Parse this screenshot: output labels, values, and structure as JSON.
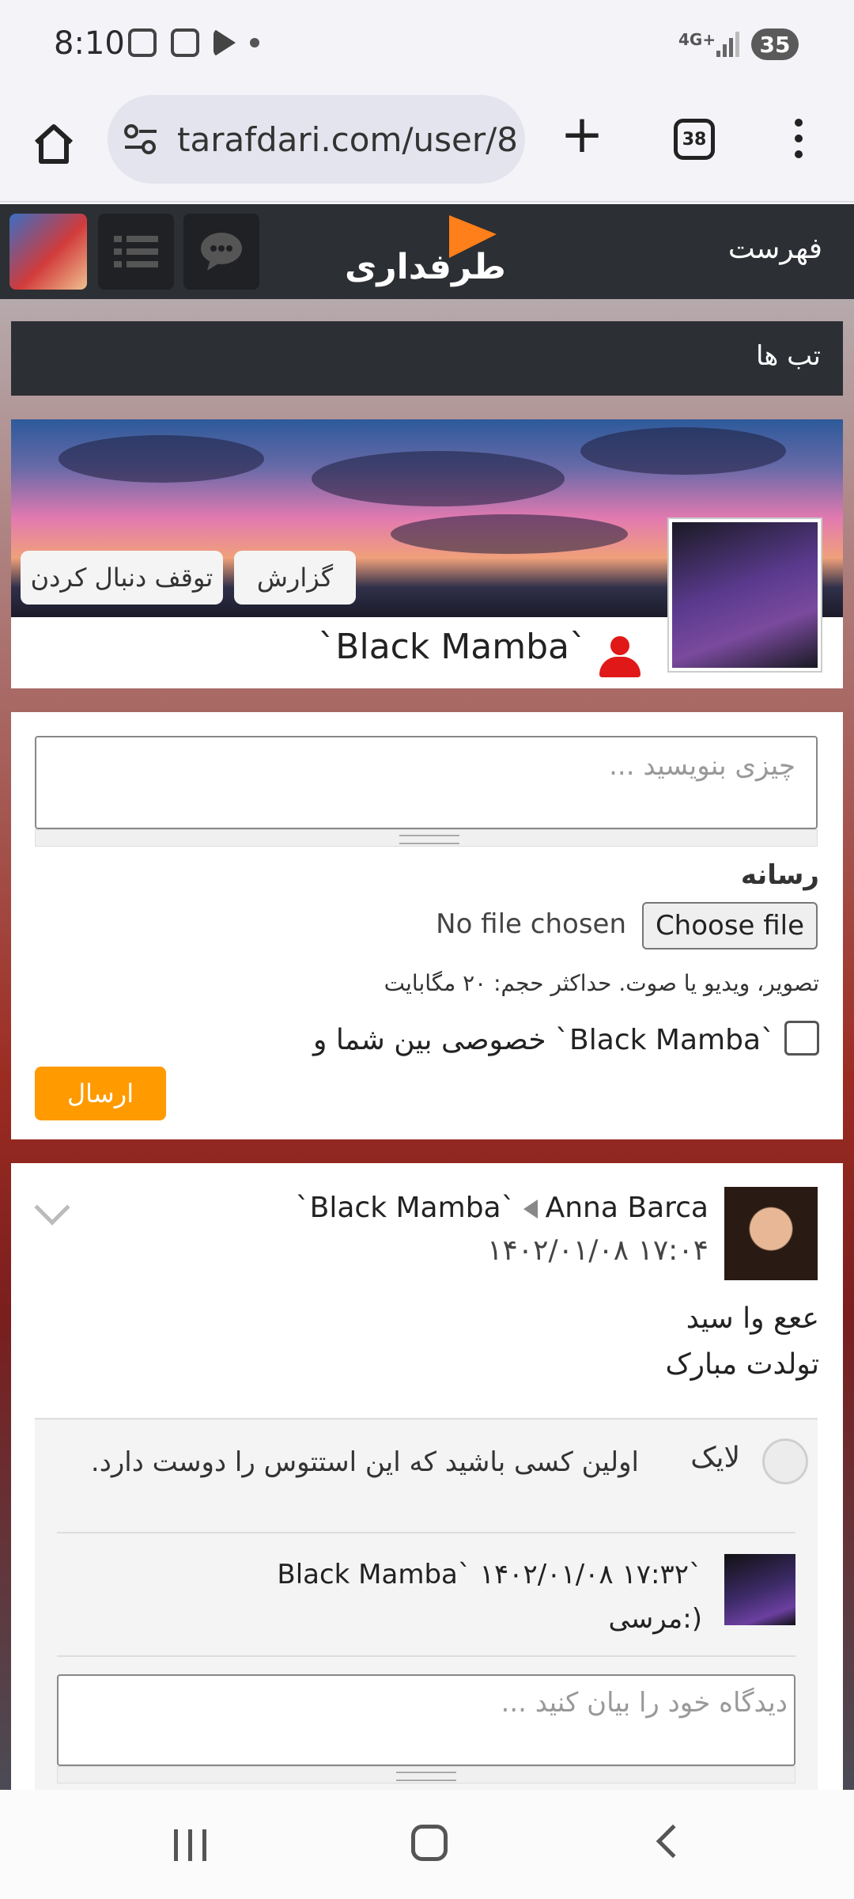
{
  "status": {
    "time": "8:10",
    "network": "4G+",
    "battery": "35"
  },
  "browser": {
    "url": "tarafdari.com/user/8",
    "tab_count": "38"
  },
  "header": {
    "logo_text": "طرفداری",
    "menu_label": "فهرست"
  },
  "tabs_label": "تب ها",
  "profile": {
    "name": "`Black Mamba`",
    "report_label": "گزارش",
    "unfollow_label": "توقف دنبال کردن"
  },
  "post": {
    "placeholder": "چیزی بنویسید ...",
    "media_label": "رسانه",
    "choose_file_label": "Choose file",
    "no_file_label": "No file chosen",
    "media_hint": "تصویر، ویدیو یا صوت. حداکثر حجم: ۲۰ مگابایت",
    "private_label": "خصوصی بین شما و `Black Mamba`",
    "send_label": "ارسال"
  },
  "feed": {
    "from": "Anna Barca",
    "to": "`Black Mamba`",
    "date": "۱۴۰۲/۰۱/۰۸ ۱۷:۰۴",
    "line1": "ععع وا سید",
    "line2": "تولدت مبارک",
    "like_label": "لایک",
    "like_text": "اولین کسی باشید که این استتوس را دوست دارد.",
    "reply_author": "Black Mamba` ۱۴۰۲/۰۱/۰۸ ۱۷:۳۲`",
    "reply_text": "مرسی:)",
    "comment_placeholder": "دیدگاه خود را بیان کنید ..."
  }
}
